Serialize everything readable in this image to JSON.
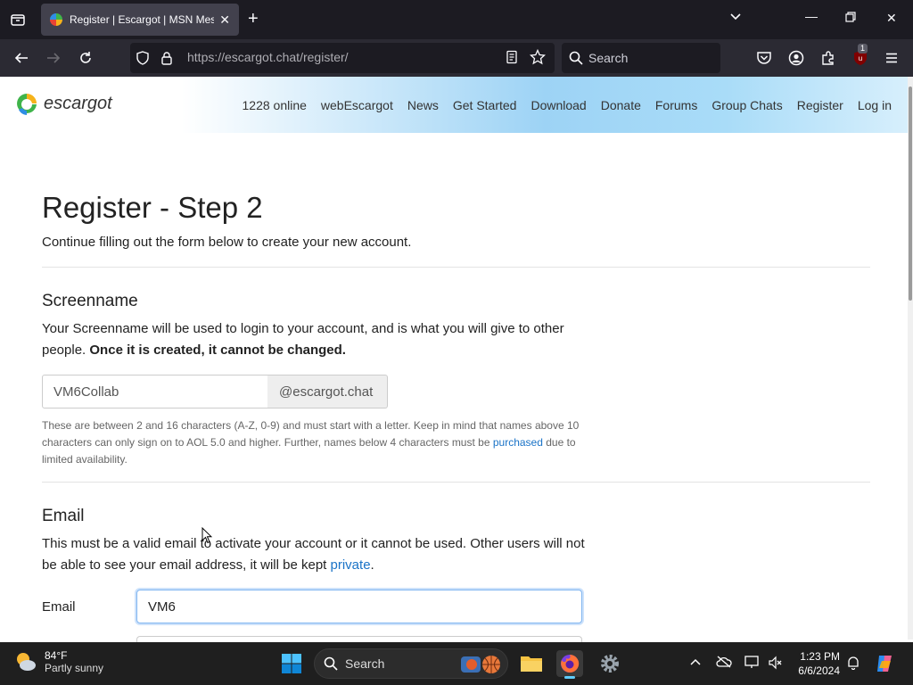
{
  "browser": {
    "tab_title": "Register | Escargot | MSN Messenger",
    "url_host": "https://escargot.chat",
    "url_path": "/register/",
    "search_placeholder": "Search",
    "extension_badge": "1"
  },
  "site": {
    "logo_text": "escargot",
    "nav": [
      "1228 online",
      "webEscargot",
      "News",
      "Get Started",
      "Download",
      "Donate",
      "Forums",
      "Group Chats",
      "Register",
      "Log in"
    ]
  },
  "page": {
    "title": "Register - Step 2",
    "lead": "Continue filling out the form below to create your new account.",
    "screenname": {
      "heading": "Screenname",
      "desc": "Your Screenname will be used to login to your account, and is what you will give to other people.",
      "desc_bold": "Once it is created, it cannot be changed.",
      "value": "VM6Collab",
      "suffix": "@escargot.chat",
      "help_before": "These are between 2 and 16 characters (A-Z, 0-9) and must start with a letter. Keep in mind that names above 10 characters can only sign on to AOL 5.0 and higher. Further, names below 4 characters must be",
      "help_link": "purchased",
      "help_after": "due to limited availability."
    },
    "email": {
      "heading": "Email",
      "desc": "This must be a valid email to activate your account or it cannot be used. Other users will not be able to see your email address, it will be kept",
      "desc_link": "private",
      "desc_end": ".",
      "label": "Email",
      "value": "VM6"
    }
  },
  "taskbar": {
    "temp": "84°F",
    "condition": "Partly sunny",
    "search_placeholder": "Search",
    "time": "1:23 PM",
    "date": "6/6/2024"
  }
}
